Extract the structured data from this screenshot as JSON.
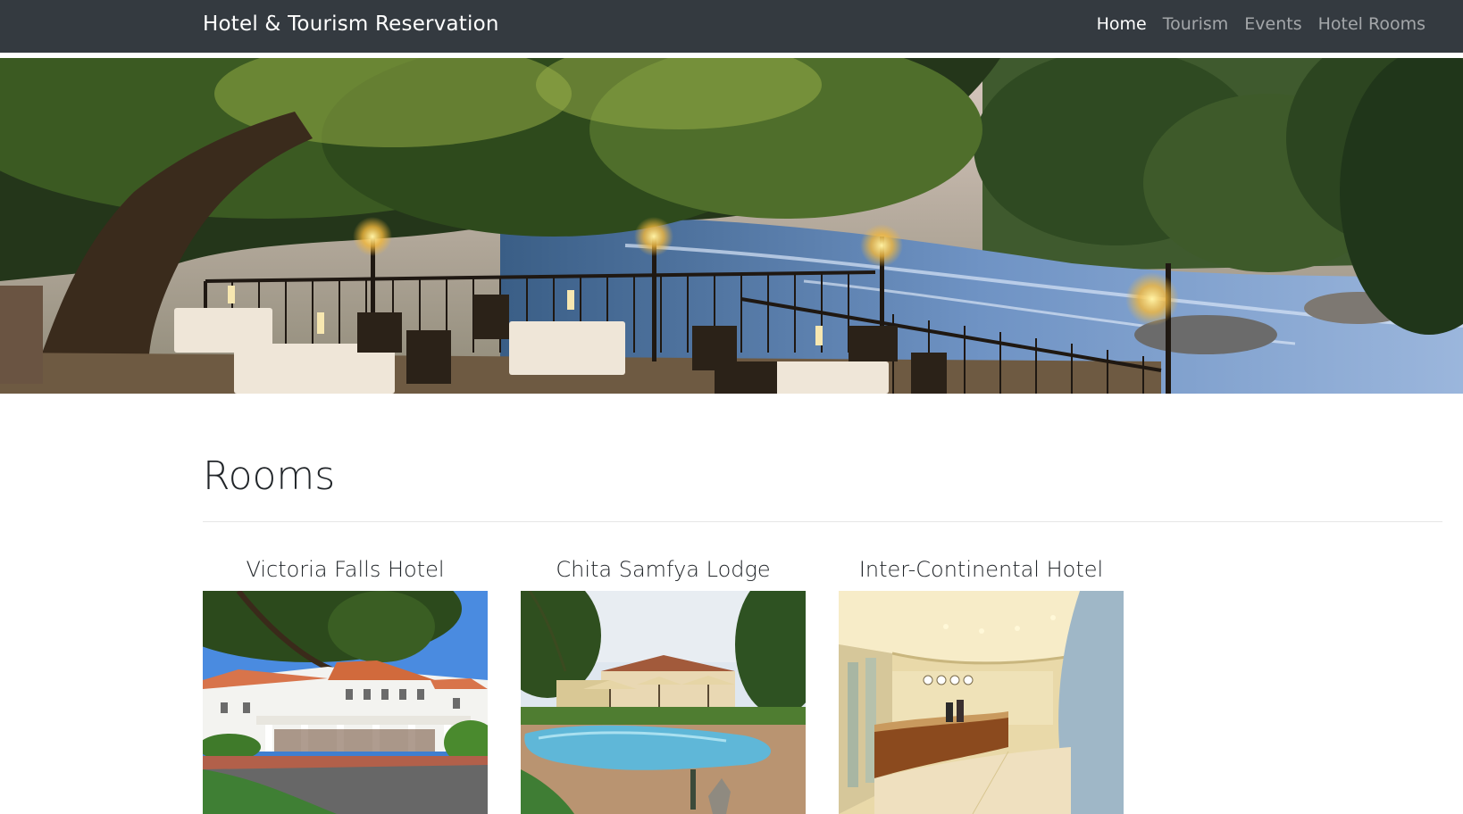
{
  "navbar": {
    "brand": "Hotel & Tourism Reservation",
    "links": [
      {
        "label": "Home",
        "active": true
      },
      {
        "label": "Tourism",
        "active": false
      },
      {
        "label": "Events",
        "active": false
      },
      {
        "label": "Hotel Rooms",
        "active": false
      }
    ]
  },
  "main": {
    "section_title": "Rooms",
    "cards": [
      {
        "title": "Victoria Falls Hotel"
      },
      {
        "title": "Chita Samfya Lodge"
      },
      {
        "title": "Inter-Continental Hotel"
      }
    ]
  },
  "colors": {
    "navbar_bg": "#343a40",
    "text": "#212529",
    "nav_inactive": "rgba(255,255,255,0.55)"
  }
}
